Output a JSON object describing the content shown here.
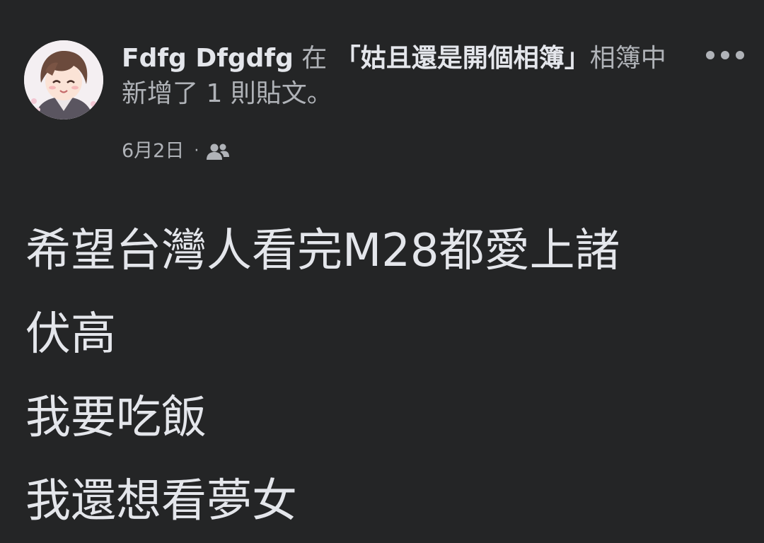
{
  "post": {
    "author": "Fdfg Dfgdfg",
    "action_prefix": " 在 ",
    "album_name": "「姑且還是開個相簿」",
    "action_suffix": "相簿中新增了 1 則貼文。",
    "date": "6月2日",
    "separator": "·",
    "audience_icon": "friends-icon",
    "more_icon": "more-horizontal-icon",
    "body_lines": [
      "希望台灣人看完M28都愛上諸",
      "伏高",
      "我要吃飯",
      "我還想看夢女"
    ]
  },
  "colors": {
    "background": "#242526",
    "primary_text": "#e4e6eb",
    "secondary_text": "#b0b3b8"
  }
}
